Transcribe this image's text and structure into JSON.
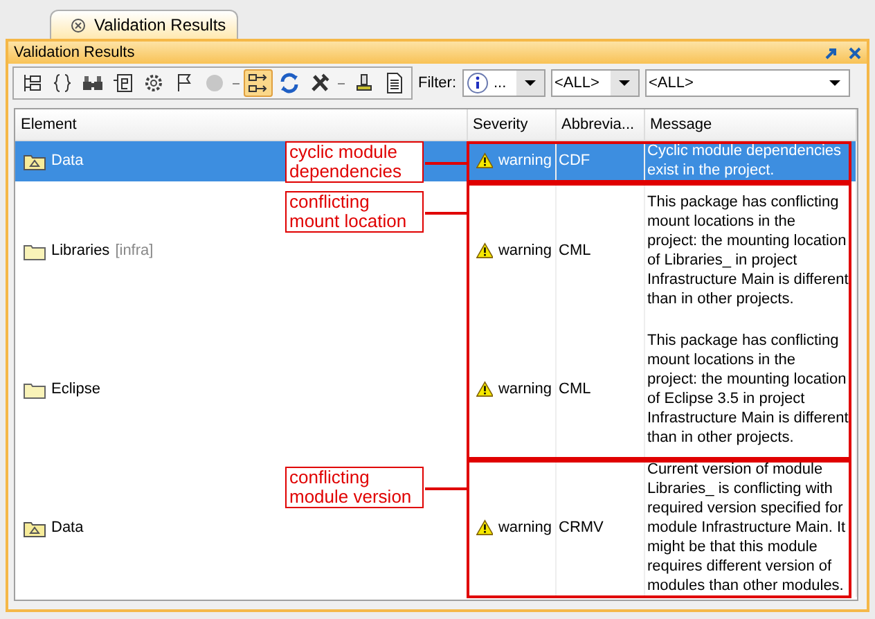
{
  "tab": {
    "label": "Validation Results",
    "selected": true
  },
  "panel": {
    "title": "Validation Results"
  },
  "toolbar": [
    {
      "kind": "button",
      "selected": false,
      "disabled": false
    },
    {
      "kind": "button",
      "selected": false,
      "disabled": false
    },
    {
      "kind": "button",
      "selected": false,
      "disabled": false
    },
    {
      "kind": "button",
      "selected": false,
      "disabled": false
    },
    {
      "kind": "button",
      "selected": false,
      "disabled": false
    },
    {
      "kind": "button",
      "selected": false,
      "disabled": false
    },
    {
      "kind": "button",
      "selected": false,
      "disabled": true
    },
    {
      "kind": "separator"
    },
    {
      "kind": "button",
      "selected": true,
      "disabled": false
    },
    {
      "kind": "button",
      "selected": false,
      "disabled": false
    },
    {
      "kind": "button",
      "selected": false,
      "disabled": false
    },
    {
      "kind": "separator"
    },
    {
      "kind": "button",
      "selected": false,
      "disabled": false
    },
    {
      "kind": "button",
      "selected": false,
      "disabled": false
    }
  ],
  "filter": {
    "label": "Filter:",
    "severity": "...",
    "type": "<ALL>",
    "scope": "<ALL>"
  },
  "table": {
    "columns": [
      "Element",
      "Severity",
      "Abbrevia...",
      "Message"
    ],
    "rows": [
      {
        "element": "Data",
        "kind": "package",
        "severity": "warning",
        "abbreviation": "CDF",
        "message": "Cyclic module dependencies exist in the project.",
        "selected": true
      },
      {
        "element": "Libraries",
        "suffix": "[infra]",
        "kind": "folder",
        "severity": "warning",
        "abbreviation": "CML",
        "message": "This package has conflicting mount locations in the project: the mounting location of Libraries_ in project Infrastructure Main is different than in other projects.",
        "selected": false
      },
      {
        "element": "Eclipse",
        "kind": "folder",
        "severity": "warning",
        "abbreviation": "CML",
        "message": "This package has conflicting mount locations in the project: the mounting location of Eclipse 3.5 in project Infrastructure Main is different than in other projects.",
        "selected": false
      },
      {
        "element": "Data",
        "kind": "package",
        "severity": "warning",
        "abbreviation": "CRMV",
        "message": "Current version of module Libraries_ is conflicting with required version specified for module Infrastructure Main. It might be that this module requires different version of modules than other modules.",
        "selected": false
      }
    ]
  },
  "annotations": [
    {
      "text": "cyclic module dependencies"
    },
    {
      "text": "conflicting mount location"
    },
    {
      "text": "conflicting module version"
    }
  ]
}
